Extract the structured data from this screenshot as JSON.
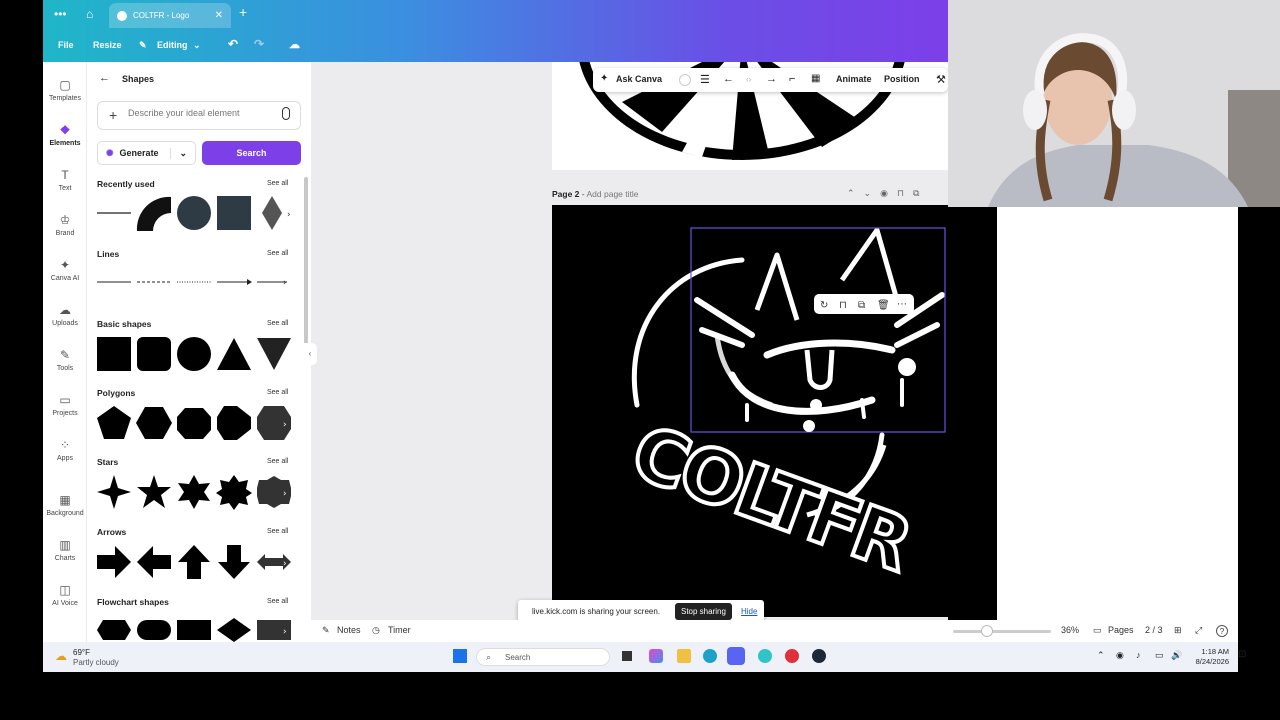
{
  "browser": {
    "tab_title": "COLTFR - Logo",
    "menu_icon": "more-dots-icon",
    "home_icon": "home-icon",
    "close_glyph": "✕",
    "new_tab_glyph": "+"
  },
  "header": {
    "file": "File",
    "resize": "Resize",
    "editing": "Editing"
  },
  "rail": {
    "items": [
      {
        "label": "Templates",
        "icon": "▢"
      },
      {
        "label": "Elements",
        "icon": "❖"
      },
      {
        "label": "Text",
        "icon": "T"
      },
      {
        "label": "Brand",
        "icon": "♔"
      },
      {
        "label": "Canva AI",
        "icon": "✦"
      },
      {
        "label": "Uploads",
        "icon": "☁"
      },
      {
        "label": "Tools",
        "icon": "✎"
      },
      {
        "label": "Projects",
        "icon": "▭"
      },
      {
        "label": "Apps",
        "icon": "⁘"
      },
      {
        "label": "Background",
        "icon": "▦"
      },
      {
        "label": "Charts",
        "icon": "▥"
      },
      {
        "label": "AI Voice",
        "icon": "◫"
      }
    ]
  },
  "panel": {
    "title": "Shapes",
    "back_glyph": "←",
    "search_placeholder": "Describe your ideal element",
    "generate": "Generate",
    "search": "Search",
    "see_all": "See all",
    "sections": {
      "recently_used": "Recently used",
      "lines": "Lines",
      "basic_shapes": "Basic shapes",
      "polygons": "Polygons",
      "stars": "Stars",
      "arrows": "Arrows",
      "flowchart": "Flowchart shapes"
    }
  },
  "toolbar": {
    "ask_canva": "Ask Canva",
    "animate": "Animate",
    "position": "Position"
  },
  "page2": {
    "label": "Page 2",
    "separator": " - ",
    "title_placeholder": "Add page title",
    "artwork_text": "COLTFR"
  },
  "share_banner": {
    "message": "live.kick.com is sharing your screen.",
    "stop": "Stop sharing",
    "hide": "Hide"
  },
  "bottom": {
    "notes": "Notes",
    "timer": "Timer",
    "zoom": "36%",
    "zoom_level": 0.36,
    "pages": "Pages",
    "page_count": "2 / 3",
    "help": "?"
  },
  "taskbar": {
    "temp": "69°F",
    "weather": "Partly cloudy",
    "search": "Search",
    "time": "1:18 AM",
    "date": "8/24/2026"
  },
  "colors": {
    "accent": "#7d3fe8",
    "header_start": "#1fb6c8",
    "header_end": "#7d3fe8",
    "selection": "#6a4fe6"
  }
}
